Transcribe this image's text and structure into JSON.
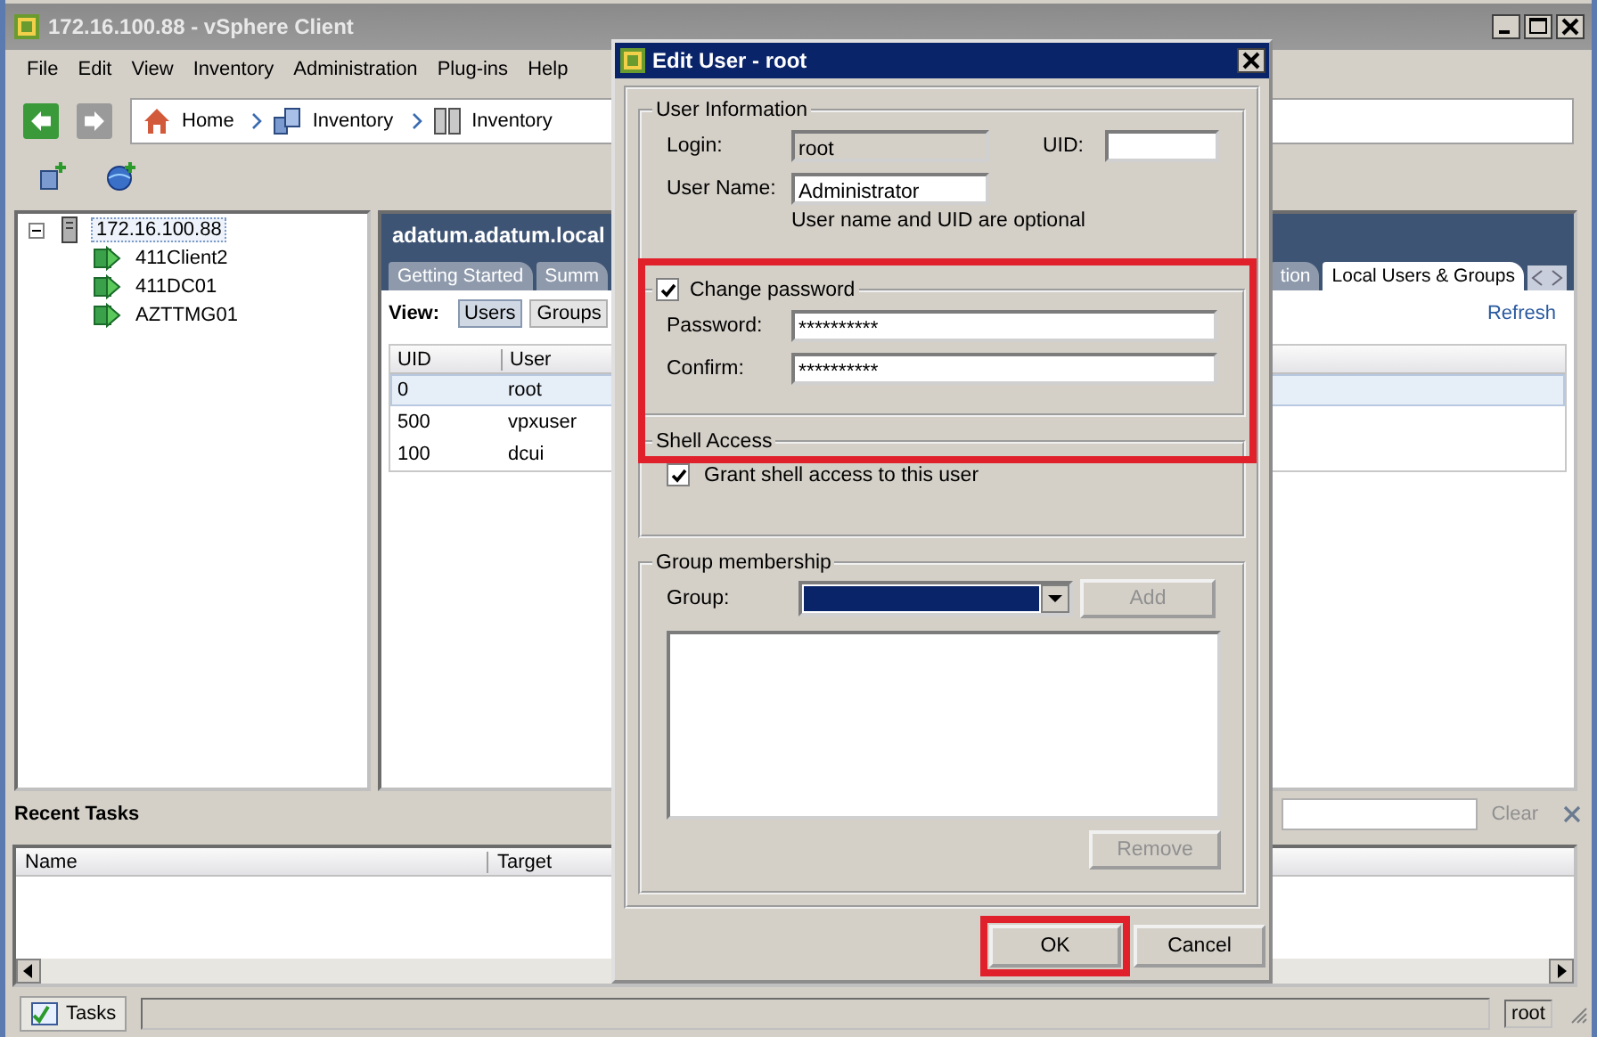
{
  "window": {
    "title": "172.16.100.88 - vSphere Client"
  },
  "menu": [
    "File",
    "Edit",
    "View",
    "Inventory",
    "Administration",
    "Plug-ins",
    "Help"
  ],
  "breadcrumb": [
    "Home",
    "Inventory",
    "Inventory"
  ],
  "tree": {
    "label": "172.16.100.88",
    "selected": true,
    "expanded": true,
    "children": [
      {
        "label": "411Client2"
      },
      {
        "label": "411DC01"
      },
      {
        "label": "AZTTMG01"
      }
    ]
  },
  "host_panel": {
    "title": "adatum.adatum.local",
    "tabs": [
      {
        "label": "Getting Started",
        "selected": false
      },
      {
        "label": "Summ",
        "selected": false
      },
      {
        "label": "tion",
        "selected": false
      },
      {
        "label": "Local Users & Groups",
        "selected": true
      }
    ],
    "view_label": "View:",
    "view_buttons": [
      {
        "label": "Users",
        "selected": true
      },
      {
        "label": "Groups",
        "selected": false
      }
    ],
    "refresh": "Refresh",
    "table": {
      "columns": [
        "UID",
        "User"
      ],
      "rows": [
        {
          "cells": [
            "0",
            "root"
          ],
          "selected": true
        },
        {
          "cells": [
            "500",
            "vpxuser"
          ],
          "selected": false
        },
        {
          "cells": [
            "100",
            "dcui"
          ],
          "selected": false
        }
      ]
    }
  },
  "recent_tasks": {
    "title": "Recent Tasks",
    "clear": "Clear",
    "columns": [
      "Name",
      "Target"
    ]
  },
  "status_bar": {
    "tasks_button": "Tasks",
    "user": "root"
  },
  "dialog": {
    "title": "Edit User - root",
    "user_info": {
      "legend": "User Information",
      "login_label": "Login:",
      "login": "root",
      "uid_label": "UID:",
      "username_label": "User Name:",
      "username": "Administrator",
      "hint": "User name and UID are optional"
    },
    "password": {
      "legend": "Change password",
      "checked": true,
      "highlighted": true,
      "password_label": "Password:",
      "password": "**********",
      "confirm_label": "Confirm:",
      "confirm": "**********"
    },
    "shell": {
      "legend": "Shell Access",
      "option": "Grant shell access to this user",
      "checked": true
    },
    "groups": {
      "legend": "Group membership",
      "group_label": "Group:",
      "add": "Add",
      "add_disabled": true,
      "remove": "Remove",
      "remove_disabled": true
    },
    "buttons": [
      {
        "label": "OK",
        "highlighted": true
      },
      {
        "label": "Cancel",
        "highlighted": false
      }
    ]
  }
}
